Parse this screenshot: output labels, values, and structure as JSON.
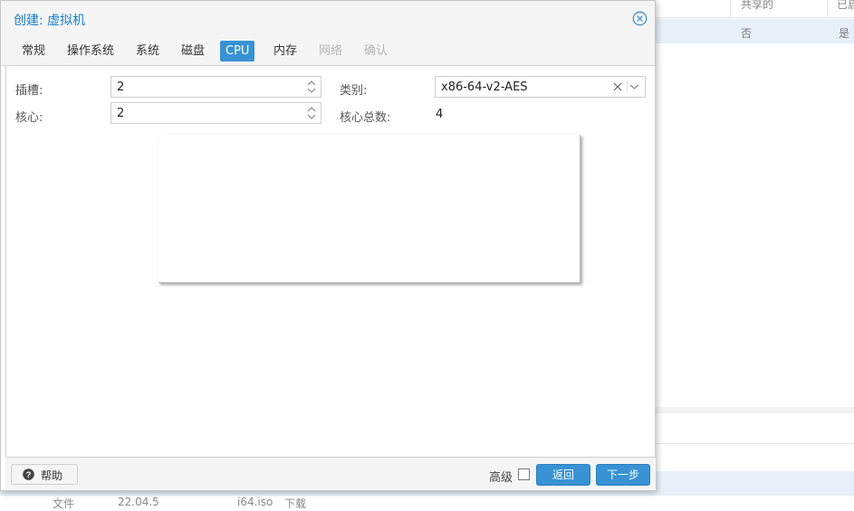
{
  "background": {
    "header_columns": [
      "共享的",
      "已启"
    ],
    "row_cells": [
      "否",
      "是"
    ],
    "bottom_text": [
      "文件",
      "22.04.5",
      "i64.iso",
      "下载"
    ]
  },
  "dialog": {
    "title": "创建: 虚拟机",
    "tabs": [
      {
        "label": "常规",
        "state": "normal"
      },
      {
        "label": "操作系统",
        "state": "normal"
      },
      {
        "label": "系统",
        "state": "normal"
      },
      {
        "label": "磁盘",
        "state": "normal"
      },
      {
        "label": "CPU",
        "state": "active"
      },
      {
        "label": "内存",
        "state": "normal"
      },
      {
        "label": "网络",
        "state": "disabled"
      },
      {
        "label": "确认",
        "state": "disabled"
      }
    ],
    "cpu": {
      "sockets_label": "插槽:",
      "sockets_value": "2",
      "cores_label": "核心:",
      "cores_value": "2",
      "type_label": "类别:",
      "type_value": "x86-64-v2-AES",
      "total_cores_label": "核心总数:",
      "total_cores_value": "4"
    },
    "footer": {
      "help_label": "帮助",
      "advanced_label": "高级",
      "advanced_checked": false,
      "back_label": "返回",
      "next_label": "下一步"
    }
  },
  "colors": {
    "accent": "#3892d4",
    "title": "#157fcc",
    "disabled_tab": "#b5b5b5"
  }
}
